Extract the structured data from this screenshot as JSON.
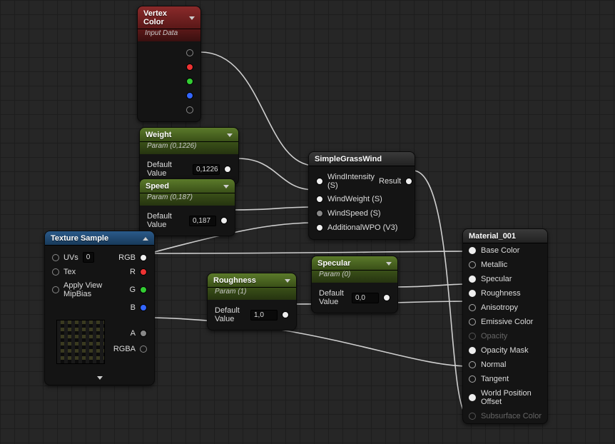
{
  "nodes": {
    "vertexColor": {
      "title": "Vertex Color",
      "subtitle": "Input Data",
      "outputs": [
        "white",
        "red",
        "green",
        "blue",
        "alpha"
      ]
    },
    "weight": {
      "title": "Weight",
      "subtitle": "Param (0,1226)",
      "defaultLabel": "Default Value",
      "defaultValue": "0,1226"
    },
    "speed": {
      "title": "Speed",
      "subtitle": "Param (0,187)",
      "defaultLabel": "Default Value",
      "defaultValue": "0,187"
    },
    "roughness": {
      "title": "Roughness",
      "subtitle": "Param (1)",
      "defaultLabel": "Default Value",
      "defaultValue": "1,0"
    },
    "specular": {
      "title": "Specular",
      "subtitle": "Param (0)",
      "defaultLabel": "Default Value",
      "defaultValue": "0,0"
    },
    "texSample": {
      "title": "Texture Sample",
      "inputs": {
        "uvs": "UVs",
        "uvsValue": "0",
        "tex": "Tex",
        "mip": "Apply View MipBias"
      },
      "outputs": {
        "rgb": "RGB",
        "r": "R",
        "g": "G",
        "b": "B",
        "a": "A",
        "rgba": "RGBA"
      }
    },
    "grassWind": {
      "title": "SimpleGrassWind",
      "inputs": {
        "intensity": "WindIntensity (S)",
        "weight": "WindWeight (S)",
        "speed": "WindSpeed (S)",
        "awpo": "AdditionalWPO (V3)"
      },
      "outputs": {
        "result": "Result"
      }
    },
    "material": {
      "title": "Material_001",
      "pins": [
        {
          "label": "Base Color",
          "connected": true
        },
        {
          "label": "Metallic",
          "connected": false
        },
        {
          "label": "Specular",
          "connected": true
        },
        {
          "label": "Roughness",
          "connected": true
        },
        {
          "label": "Anisotropy",
          "connected": false
        },
        {
          "label": "Emissive Color",
          "connected": false
        },
        {
          "label": "Opacity",
          "connected": false,
          "dim": true
        },
        {
          "label": "Opacity Mask",
          "connected": true
        },
        {
          "label": "Normal",
          "connected": false
        },
        {
          "label": "Tangent",
          "connected": false
        },
        {
          "label": "World Position Offset",
          "connected": true
        },
        {
          "label": "Subsurface Color",
          "connected": false,
          "dim": true
        }
      ]
    }
  }
}
